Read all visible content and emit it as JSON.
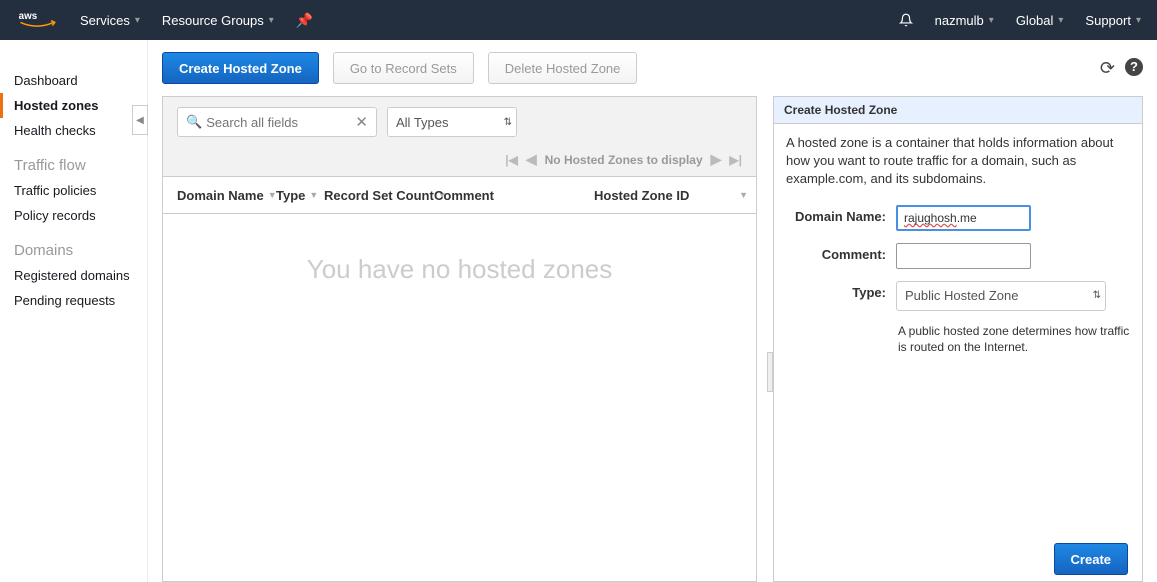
{
  "topnav": {
    "services": "Services",
    "resource_groups": "Resource Groups",
    "user": "nazmulb",
    "region": "Global",
    "support": "Support"
  },
  "sidebar": {
    "items": [
      "Dashboard",
      "Hosted zones",
      "Health checks"
    ],
    "traffic_heading": "Traffic flow",
    "traffic_items": [
      "Traffic policies",
      "Policy records"
    ],
    "domains_heading": "Domains",
    "domains_items": [
      "Registered domains",
      "Pending requests"
    ]
  },
  "toolbar": {
    "create": "Create Hosted Zone",
    "goto": "Go to Record Sets",
    "delete": "Delete Hosted Zone"
  },
  "filters": {
    "search_placeholder": "Search all fields",
    "type_select": "All Types"
  },
  "pager": {
    "status": "No Hosted Zones to display"
  },
  "columns": {
    "domain": "Domain Name",
    "type": "Type",
    "rsc": "Record Set Count",
    "comment": "Comment",
    "hzid": "Hosted Zone ID"
  },
  "empty": "You have no hosted zones",
  "panel": {
    "title": "Create Hosted Zone",
    "description": "A hosted zone is a container that holds information about how you want to route traffic for a domain, such as example.com, and its subdomains.",
    "domain_label": "Domain Name:",
    "domain_value_a": "rajughosh",
    "domain_value_b": ".me",
    "comment_label": "Comment:",
    "type_label": "Type:",
    "type_value": "Public Hosted Zone",
    "type_help": "A public hosted zone determines how traffic is routed on the Internet.",
    "create_btn": "Create"
  }
}
